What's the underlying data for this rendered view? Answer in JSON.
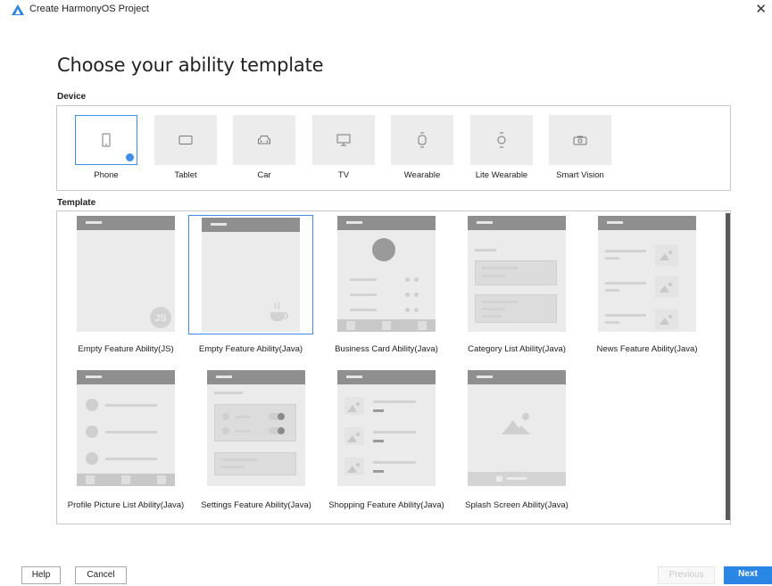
{
  "window": {
    "title": "Create HarmonyOS Project"
  },
  "heading": "Choose your ability template",
  "device_section": {
    "label": "Device",
    "items": [
      {
        "name": "Phone",
        "icon": "phone-icon",
        "selected": true
      },
      {
        "name": "Tablet",
        "icon": "tablet-icon"
      },
      {
        "name": "Car",
        "icon": "car-icon"
      },
      {
        "name": "TV",
        "icon": "tv-icon"
      },
      {
        "name": "Wearable",
        "icon": "watch-icon"
      },
      {
        "name": "Lite Wearable",
        "icon": "lite-watch-icon"
      },
      {
        "name": "Smart Vision",
        "icon": "camera-icon"
      }
    ]
  },
  "template_section": {
    "label": "Template",
    "items": [
      {
        "name": "Empty Feature Ability(JS)"
      },
      {
        "name": "Empty Feature Ability(Java)",
        "selected": true
      },
      {
        "name": "Business Card Ability(Java)"
      },
      {
        "name": "Category List Ability(Java)"
      },
      {
        "name": "News Feature Ability(Java)"
      },
      {
        "name": "Profile Picture List Ability(Java)"
      },
      {
        "name": "Settings Feature Ability(Java)"
      },
      {
        "name": "Shopping Feature Ability(Java)"
      },
      {
        "name": "Splash Screen Ability(Java)"
      }
    ]
  },
  "footer": {
    "help": "Help",
    "cancel": "Cancel",
    "previous": "Previous",
    "next": "Next"
  },
  "colors": {
    "accent": "#2a86e4",
    "selection": "#3f8fe8"
  }
}
